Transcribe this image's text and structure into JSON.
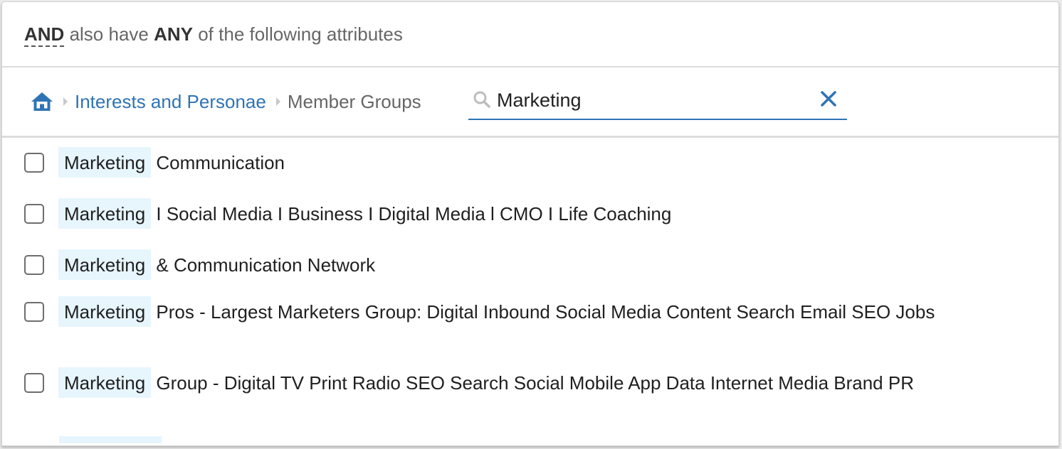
{
  "header": {
    "and_label": "AND",
    "middle_text": " also have ",
    "any_label": "ANY",
    "tail_text": " of the following attributes"
  },
  "breadcrumb": {
    "home_icon": "home-icon",
    "items": [
      {
        "label": "Interests and Personae",
        "link": true
      },
      {
        "label": "Member Groups",
        "link": false
      }
    ]
  },
  "search": {
    "value": "Marketing",
    "placeholder": "",
    "icon": "search-icon",
    "clear_icon": "close-icon"
  },
  "colors": {
    "accent": "#2f74b5",
    "highlight": "#e7f5fd",
    "text": "#1f1f1f",
    "muted": "#666666"
  },
  "results": [
    {
      "match": "Marketing",
      "rest": " Communication",
      "checked": false
    },
    {
      "match": "Marketing",
      "rest": " I Social Media I Business I Digital Media l CMO I Life Coaching",
      "checked": false
    },
    {
      "match": "Marketing",
      "rest": " & Communication Network",
      "checked": false
    },
    {
      "match": "Marketing",
      "rest": " Pros - Largest Marketers Group: Digital Inbound Social Media Content Search Email SEO Jobs",
      "checked": false
    },
    {
      "match": "Marketing",
      "rest": " Group - Digital TV Print Radio SEO Search Social Mobile App Data Internet Media Brand PR",
      "checked": false
    }
  ]
}
